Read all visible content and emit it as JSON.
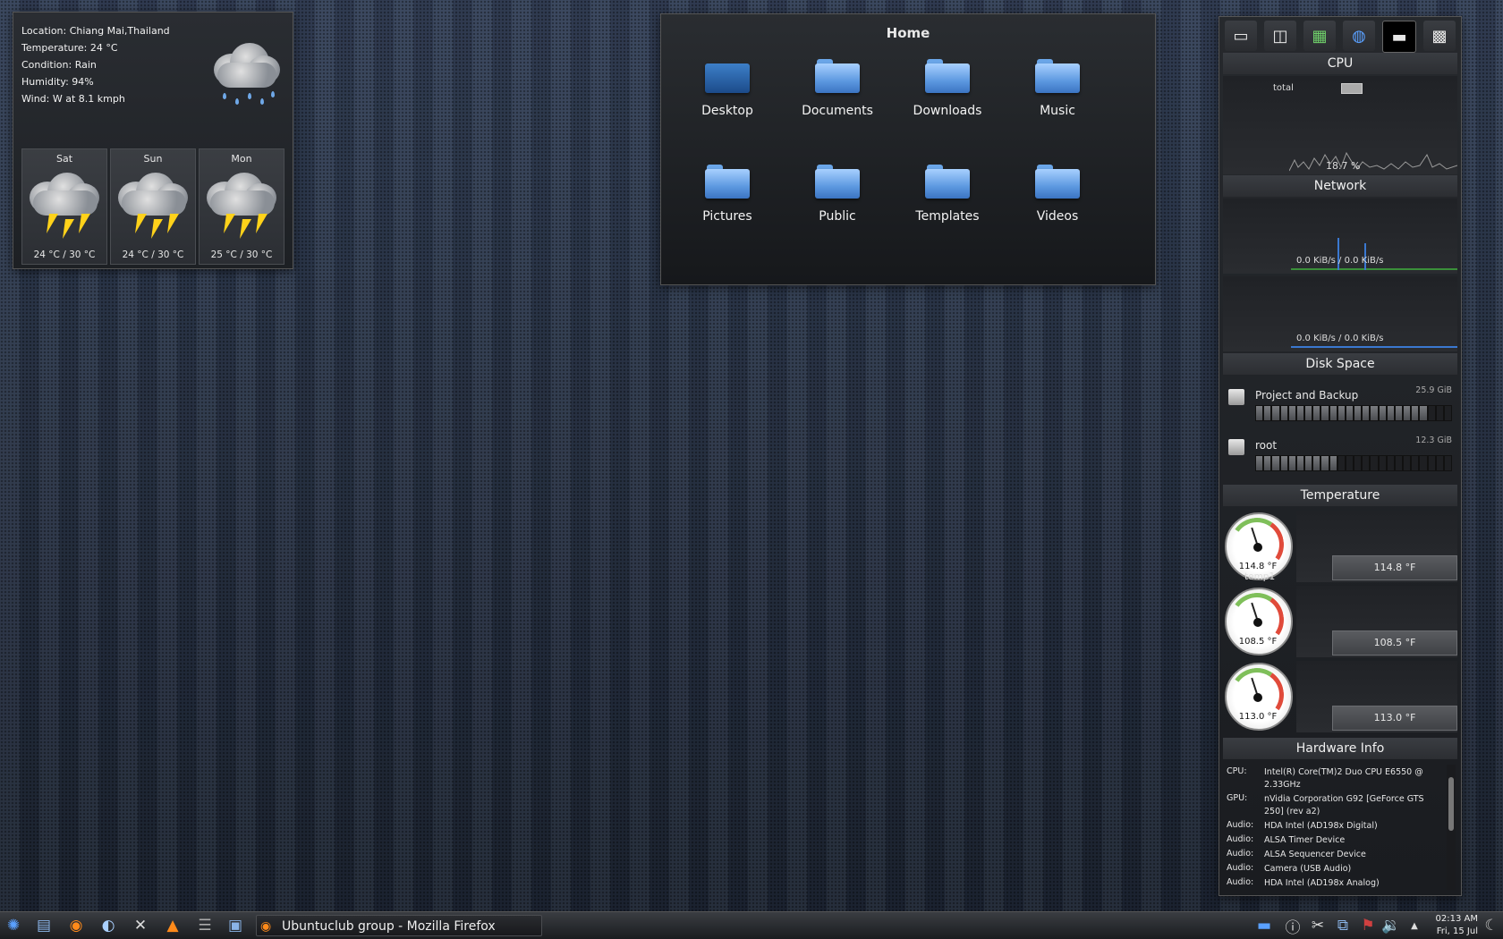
{
  "weather": {
    "location": "Location: Chiang Mai,Thailand",
    "temperature": "Temperature: 24 °C",
    "condition": "Condition: Rain",
    "humidity": "Humidity: 94%",
    "wind": "Wind: W at 8.1 kmph",
    "forecast": [
      {
        "day": "Sat",
        "temp": "24 °C / 30 °C"
      },
      {
        "day": "Sun",
        "temp": "24 °C / 30 °C"
      },
      {
        "day": "Mon",
        "temp": "25 °C / 30 °C"
      }
    ]
  },
  "home": {
    "title": "Home",
    "folders": [
      "Desktop",
      "Documents",
      "Downloads",
      "Music",
      "Pictures",
      "Public",
      "Templates",
      "Videos"
    ]
  },
  "sysmon": {
    "tabs": [
      "hdd-icon",
      "disk-icon",
      "motherboard-icon",
      "globe-icon",
      "monitor-icon",
      "chip-icon"
    ],
    "cpu": {
      "title": "CPU",
      "label": "total",
      "value": "18.7 %"
    },
    "network": {
      "title": "Network",
      "rate1": "0.0 KiB/s / 0.0 KiB/s",
      "rate2": "0.0 KiB/s / 0.0 KiB/s"
    },
    "disk": {
      "title": "Disk Space",
      "items": [
        {
          "name": "Project and Backup",
          "size": "25.9 GiB",
          "fill": 0.86
        },
        {
          "name": "root",
          "size": "12.3 GiB",
          "fill": 0.41
        }
      ]
    },
    "temperature": {
      "title": "Temperature",
      "sensors": [
        {
          "value": "114.8 °F",
          "label": "temp1"
        },
        {
          "value": "108.5 °F",
          "label": ""
        },
        {
          "value": "113.0 °F",
          "label": ""
        }
      ]
    },
    "hardware": {
      "title": "Hardware Info",
      "rows": [
        {
          "k": "CPU:",
          "v": "Intel(R) Core(TM)2 Duo CPU E6550 @ 2.33GHz"
        },
        {
          "k": "GPU:",
          "v": "nVidia Corporation G92 [GeForce GTS 250] (rev a2)"
        },
        {
          "k": "Audio:",
          "v": "HDA Intel (AD198x Digital)"
        },
        {
          "k": "Audio:",
          "v": "ALSA Timer Device"
        },
        {
          "k": "Audio:",
          "v": "ALSA Sequencer Device"
        },
        {
          "k": "Audio:",
          "v": "Camera (USB Audio)"
        },
        {
          "k": "Audio:",
          "v": "HDA Intel (AD198x Analog)"
        }
      ]
    }
  },
  "taskbar": {
    "task_title": "Ubuntuclub group - Mozilla Firefox",
    "time": "02:13 AM",
    "date": "Fri, 15 Jul"
  }
}
